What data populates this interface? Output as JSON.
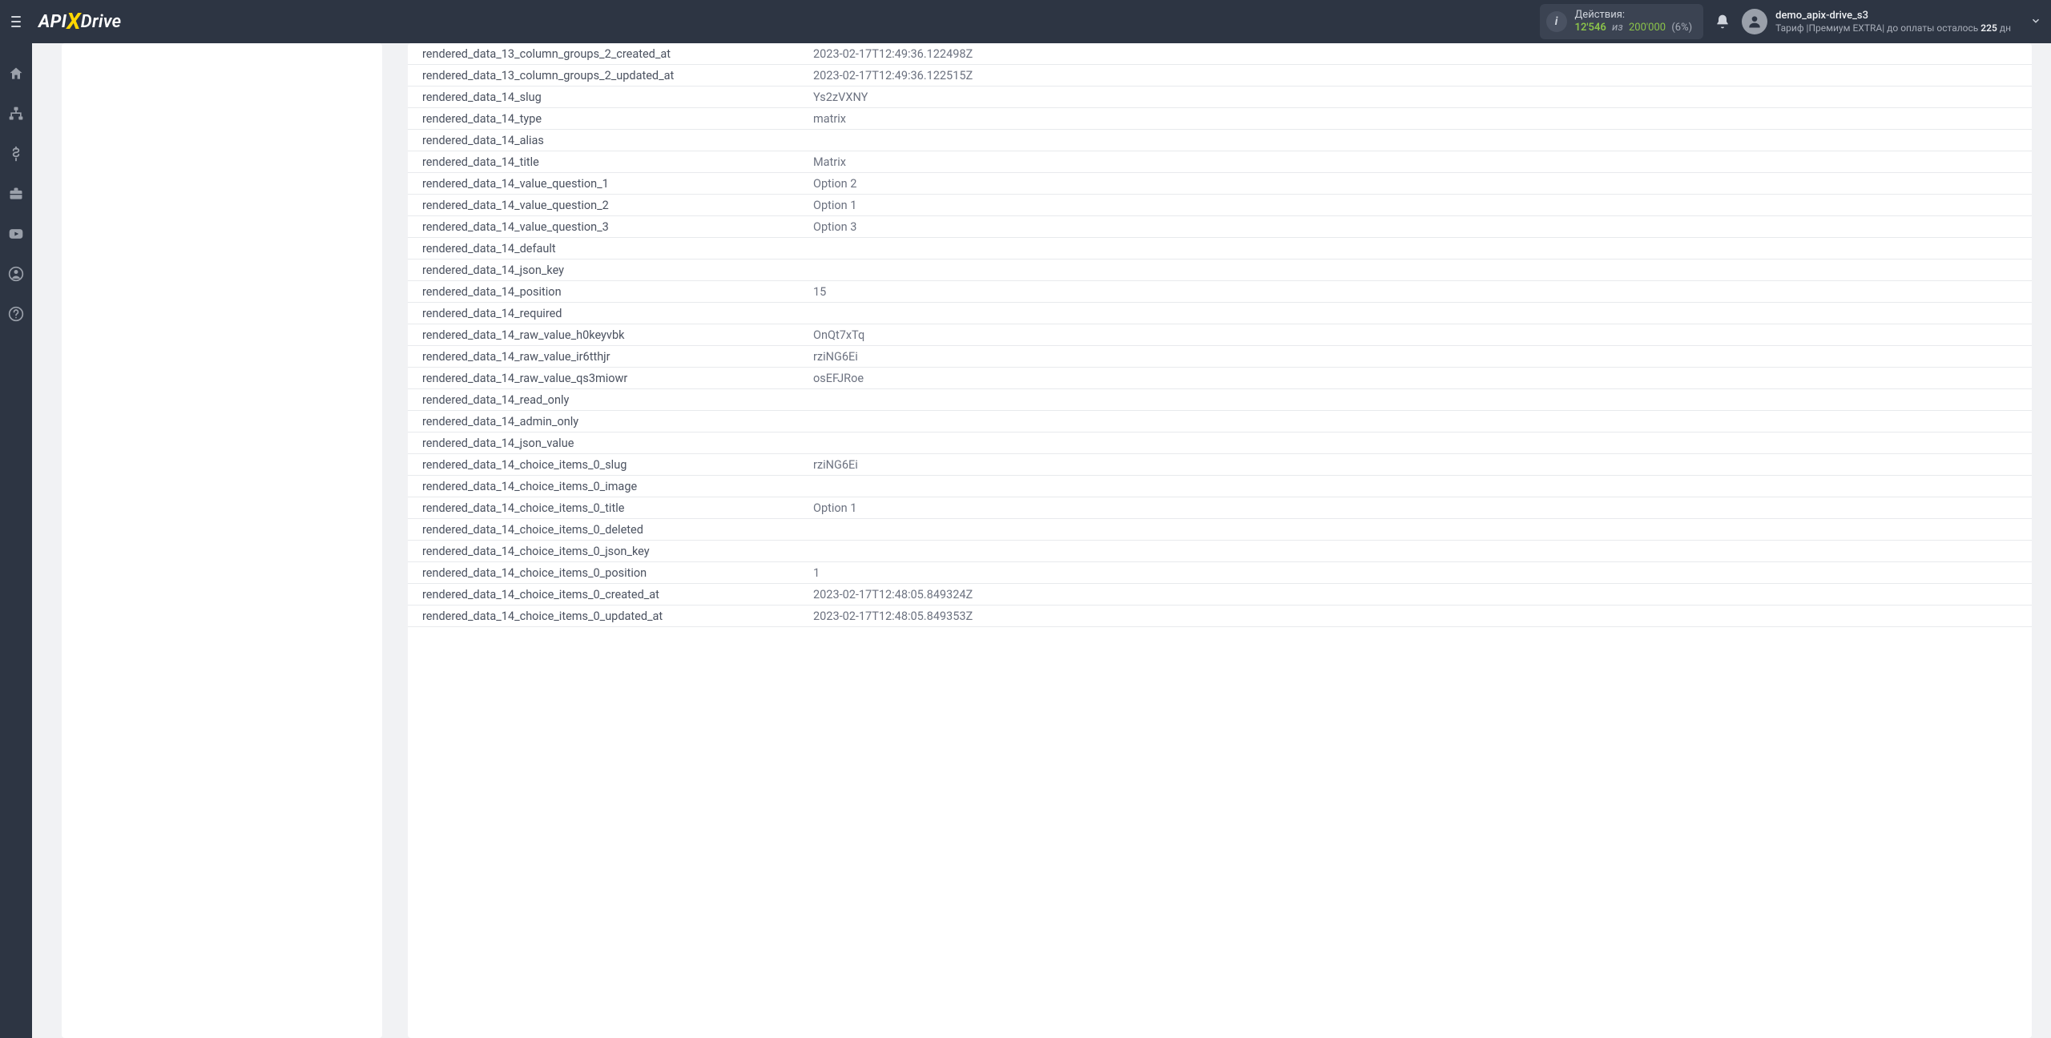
{
  "header": {
    "logo": {
      "api": "API",
      "x": "X",
      "drive": "Drive"
    },
    "actions": {
      "label": "Действия:",
      "used": "12'546",
      "of": "из",
      "limit": "200'000",
      "pct": "(6%)"
    },
    "user": {
      "name": "demo_apix-drive_s3",
      "plan_prefix": "Тариф |",
      "plan_name": "Премиум EXTRA",
      "plan_sep": "| до оплаты осталось ",
      "days": "225",
      "days_suffix": " дн"
    }
  },
  "rows": [
    {
      "k": "rendered_data_13_column_groups_2_created_at",
      "v": "2023-02-17T12:49:36.122498Z"
    },
    {
      "k": "rendered_data_13_column_groups_2_updated_at",
      "v": "2023-02-17T12:49:36.122515Z"
    },
    {
      "k": "rendered_data_14_slug",
      "v": "Ys2zVXNY"
    },
    {
      "k": "rendered_data_14_type",
      "v": "matrix"
    },
    {
      "k": "rendered_data_14_alias",
      "v": ""
    },
    {
      "k": "rendered_data_14_title",
      "v": "Matrix"
    },
    {
      "k": "rendered_data_14_value_question_1",
      "v": "Option 2"
    },
    {
      "k": "rendered_data_14_value_question_2",
      "v": "Option 1"
    },
    {
      "k": "rendered_data_14_value_question_3",
      "v": "Option 3"
    },
    {
      "k": "rendered_data_14_default",
      "v": ""
    },
    {
      "k": "rendered_data_14_json_key",
      "v": ""
    },
    {
      "k": "rendered_data_14_position",
      "v": "15"
    },
    {
      "k": "rendered_data_14_required",
      "v": ""
    },
    {
      "k": "rendered_data_14_raw_value_h0keyvbk",
      "v": "OnQt7xTq"
    },
    {
      "k": "rendered_data_14_raw_value_ir6tthjr",
      "v": "rziNG6Ei"
    },
    {
      "k": "rendered_data_14_raw_value_qs3miowr",
      "v": "osEFJRoe"
    },
    {
      "k": "rendered_data_14_read_only",
      "v": ""
    },
    {
      "k": "rendered_data_14_admin_only",
      "v": ""
    },
    {
      "k": "rendered_data_14_json_value",
      "v": ""
    },
    {
      "k": "rendered_data_14_choice_items_0_slug",
      "v": "rziNG6Ei"
    },
    {
      "k": "rendered_data_14_choice_items_0_image",
      "v": ""
    },
    {
      "k": "rendered_data_14_choice_items_0_title",
      "v": "Option 1"
    },
    {
      "k": "rendered_data_14_choice_items_0_deleted",
      "v": ""
    },
    {
      "k": "rendered_data_14_choice_items_0_json_key",
      "v": ""
    },
    {
      "k": "rendered_data_14_choice_items_0_position",
      "v": "1"
    },
    {
      "k": "rendered_data_14_choice_items_0_created_at",
      "v": "2023-02-17T12:48:05.849324Z"
    },
    {
      "k": "rendered_data_14_choice_items_0_updated_at",
      "v": "2023-02-17T12:48:05.849353Z"
    }
  ]
}
